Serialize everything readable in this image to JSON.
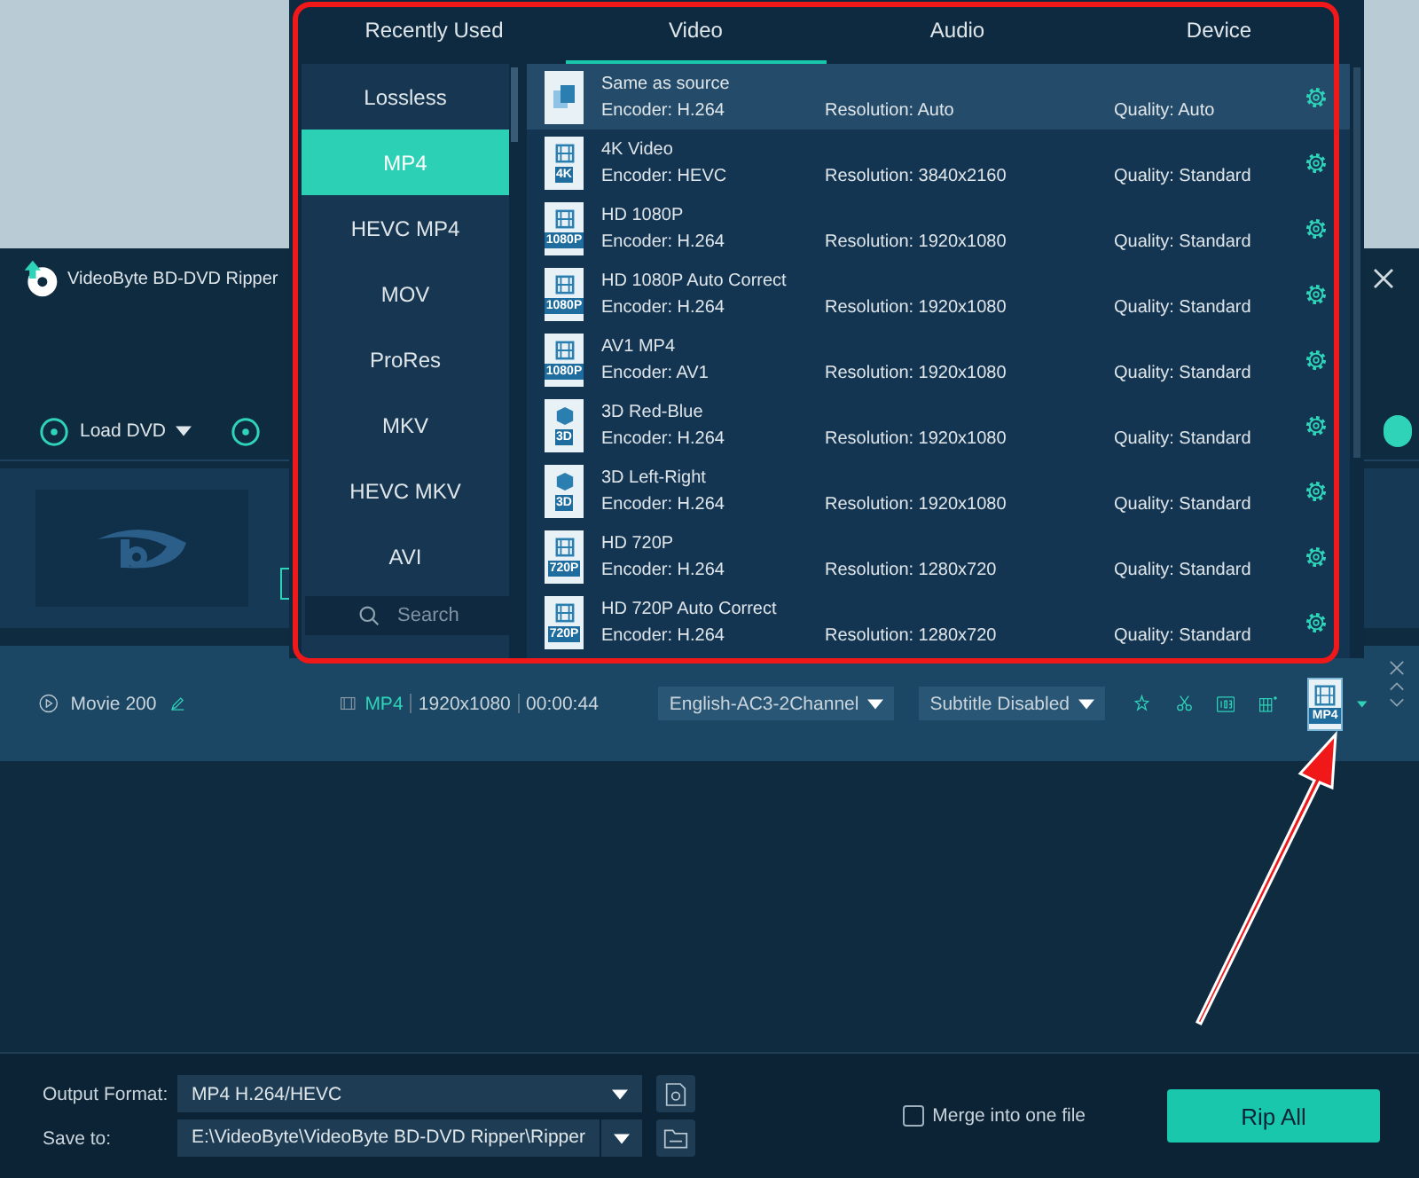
{
  "app": {
    "title": "VideoByte BD-DVD Ripper",
    "toolbar": [
      {
        "label": "Load DVD"
      }
    ],
    "movie": {
      "title": "Movie 200",
      "format": "MP4",
      "resolution": "1920x1080",
      "duration": "00:00:44",
      "audio": "English-AC3-2Channel",
      "subtitle": "Subtitle Disabled",
      "output_badge": "MP4"
    },
    "bottom": {
      "output_format_label": "Output Format:",
      "output_format": "MP4 H.264/HEVC",
      "save_to_label": "Save to:",
      "save_to": "E:\\VideoByte\\VideoByte BD-DVD Ripper\\Ripper",
      "merge_label": "Merge into one file",
      "merge_checked": false,
      "rip_button": "Rip All"
    }
  },
  "format_popup": {
    "tabs": [
      {
        "label": "Recently Used",
        "selected": false
      },
      {
        "label": "Video",
        "selected": true
      },
      {
        "label": "Audio",
        "selected": false
      },
      {
        "label": "Device",
        "selected": false
      }
    ],
    "categories": [
      {
        "label": "Lossless",
        "selected": false
      },
      {
        "label": "MP4",
        "selected": true
      },
      {
        "label": "HEVC MP4",
        "selected": false
      },
      {
        "label": "MOV",
        "selected": false
      },
      {
        "label": "ProRes",
        "selected": false
      },
      {
        "label": "MKV",
        "selected": false
      },
      {
        "label": "HEVC MKV",
        "selected": false
      },
      {
        "label": "AVI",
        "selected": false
      }
    ],
    "search_placeholder": "Search",
    "presets": [
      {
        "kind": "copy",
        "name": "Same as source",
        "encoder": "Encoder: H.264",
        "resolution": "Resolution: Auto",
        "quality": "Quality: Auto",
        "selected": true
      },
      {
        "kind": "film",
        "badge": "4K",
        "name": "4K Video",
        "encoder": "Encoder: HEVC",
        "resolution": "Resolution: 3840x2160",
        "quality": "Quality: Standard",
        "selected": false
      },
      {
        "kind": "film",
        "badge": "1080P",
        "name": "HD 1080P",
        "encoder": "Encoder: H.264",
        "resolution": "Resolution: 1920x1080",
        "quality": "Quality: Standard",
        "selected": false
      },
      {
        "kind": "film",
        "badge": "1080P",
        "name": "HD 1080P Auto Correct",
        "encoder": "Encoder: H.264",
        "resolution": "Resolution: 1920x1080",
        "quality": "Quality: Standard",
        "selected": false
      },
      {
        "kind": "film",
        "badge": "1080P",
        "name": "AV1 MP4",
        "encoder": "Encoder: AV1",
        "resolution": "Resolution: 1920x1080",
        "quality": "Quality: Standard",
        "selected": false
      },
      {
        "kind": "cube",
        "badge": "3D",
        "name": "3D Red-Blue",
        "encoder": "Encoder: H.264",
        "resolution": "Resolution: 1920x1080",
        "quality": "Quality: Standard",
        "selected": false
      },
      {
        "kind": "cube",
        "badge": "3D",
        "name": "3D Left-Right",
        "encoder": "Encoder: H.264",
        "resolution": "Resolution: 1920x1080",
        "quality": "Quality: Standard",
        "selected": false
      },
      {
        "kind": "film",
        "badge": "720P",
        "name": "HD 720P",
        "encoder": "Encoder: H.264",
        "resolution": "Resolution: 1280x720",
        "quality": "Quality: Standard",
        "selected": false
      },
      {
        "kind": "film",
        "badge": "720P",
        "name": "HD 720P Auto Correct",
        "encoder": "Encoder: H.264",
        "resolution": "Resolution: 1280x720",
        "quality": "Quality: Standard",
        "selected": false
      }
    ]
  }
}
